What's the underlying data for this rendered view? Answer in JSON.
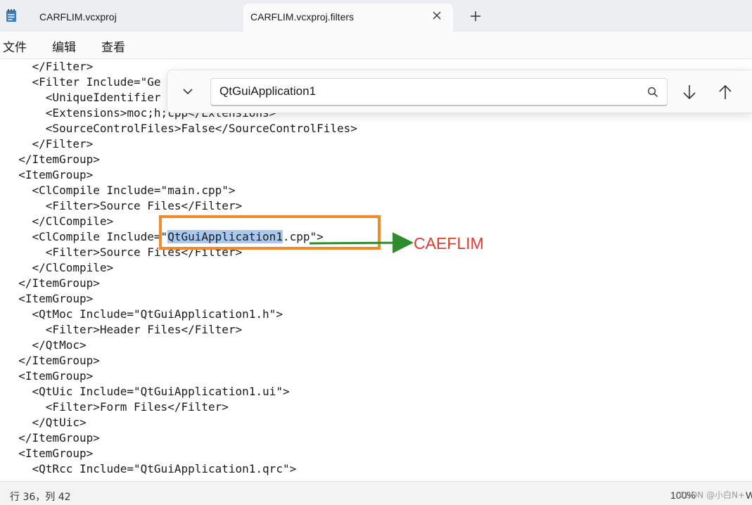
{
  "tabs": [
    {
      "label": "CARFLIM.vcxproj",
      "active": false
    },
    {
      "label": "CARFLIM.vcxproj.filters",
      "active": true
    }
  ],
  "menu": [
    "文件",
    "编辑",
    "查看"
  ],
  "code_lines": [
    "    </Filter>",
    "    <Filter Include=\"Ge",
    "      <UniqueIdentifier",
    "      <Extensions>moc;h;cpp</Extensions>",
    "      <SourceControlFiles>False</SourceControlFiles>",
    "    </Filter>",
    "  </ItemGroup>",
    "  <ItemGroup>",
    "    <ClCompile Include=\"main.cpp\">",
    "      <Filter>Source Files</Filter>",
    "    </ClCompile>",
    "    <ClCompile Include=\"QtGuiApplication1.cpp\">",
    "      <Filter>Source Files</Filter>",
    "    </ClCompile>",
    "  </ItemGroup>",
    "  <ItemGroup>",
    "    <QtMoc Include=\"QtGuiApplication1.h\">",
    "      <Filter>Header Files</Filter>",
    "    </QtMoc>",
    "  </ItemGroup>",
    "  <ItemGroup>",
    "    <QtUic Include=\"QtGuiApplication1.ui\">",
    "      <Filter>Form Files</Filter>",
    "    </QtUic>",
    "  </ItemGroup>",
    "  <ItemGroup>",
    "    <QtRcc Include=\"QtGuiApplication1.qrc\">"
  ],
  "highlight": {
    "line": 11,
    "prefix": "    <ClCompile Include=\"",
    "match": "QtGuiApplication1",
    "suffix": ".cpp\">"
  },
  "find": {
    "query": "QtGuiApplication1"
  },
  "annotation": {
    "text": "CAEFLIM",
    "box_color": "#f08a2a",
    "arrow_color": "#2e8b2e",
    "text_color": "#e03a2e"
  },
  "status": {
    "position": "行 36，列 42",
    "zoom": "100%",
    "watermark": "CSDN @小白N+",
    "trailing": "W"
  },
  "colors": {
    "selection": "#a8c8ef",
    "tabbar": "#eceef2"
  }
}
